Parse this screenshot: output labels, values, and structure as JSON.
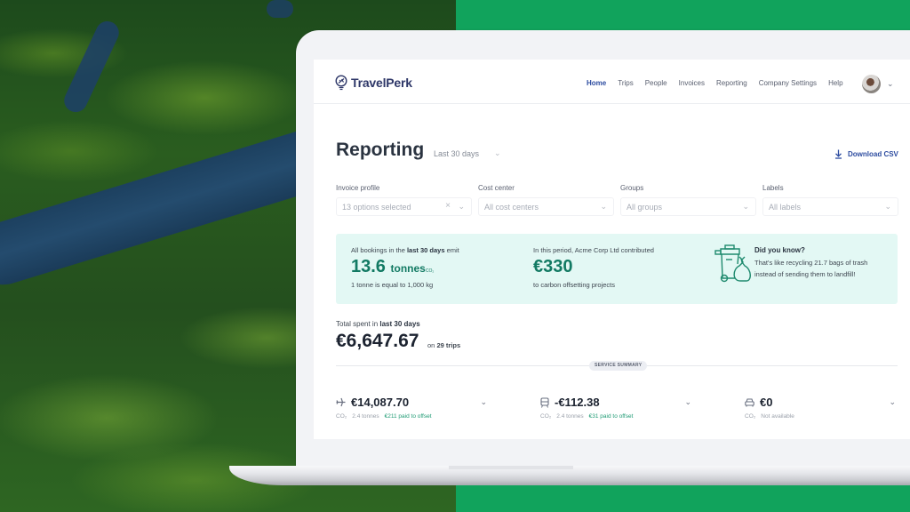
{
  "nav": {
    "brand": "TravelPerk",
    "links": [
      "Home",
      "Trips",
      "People",
      "Invoices",
      "Reporting",
      "Company Settings",
      "Help"
    ],
    "active": "Home"
  },
  "header": {
    "title": "Reporting",
    "period": "Last 30 days",
    "download_label": "Download CSV"
  },
  "filters": [
    {
      "label": "Invoice profile",
      "value": "13 options selected",
      "clearable": true
    },
    {
      "label": "Cost center",
      "value": "All cost centers"
    },
    {
      "label": "Groups",
      "value": "All groups"
    },
    {
      "label": "Labels",
      "value": "All labels"
    }
  ],
  "emissions": {
    "intro_pre": "All bookings in the ",
    "intro_bold": "last 30 days",
    "intro_post": " emit",
    "value": "13.6",
    "unit": "tonnes",
    "unit_sub": "CO₂",
    "note": "1 tonne is equal to 1,000 kg"
  },
  "contribution": {
    "intro": "In this period, Acme Corp Ltd contributed",
    "value": "€330",
    "note": "to carbon offsetting projects"
  },
  "did_you_know": {
    "title": "Did you know?",
    "line1": "That's like recycling 21.7 bags of trash",
    "line2": "instead of sending them to landfill!"
  },
  "total": {
    "label_pre": "Total spent in ",
    "label_bold": "last 30 days",
    "value": "€6,647.67",
    "trips_pre": "on ",
    "trips_bold": "29 trips"
  },
  "service_summary_label": "SERVICE SUMMARY",
  "services": [
    {
      "icon": "plane-icon",
      "amount": "€14,087.70",
      "co2_label": "CO₂",
      "tonnes": "2.4 tonnes",
      "offset": "€211 paid to offset"
    },
    {
      "icon": "train-icon",
      "amount": "-€112.38",
      "co2_label": "CO₂",
      "tonnes": "2.4 tonnes",
      "offset": "€31 paid to offset"
    },
    {
      "icon": "car-icon",
      "amount": "€0",
      "co2_label": "CO₂",
      "tonnes": "Not available",
      "offset": ""
    }
  ],
  "colors": {
    "brand_navy": "#2e3768",
    "link_blue": "#2d4ca0",
    "emission_green": "#127a63",
    "banner_bg": "#e3f8f4",
    "background_green": "#11a35c"
  }
}
